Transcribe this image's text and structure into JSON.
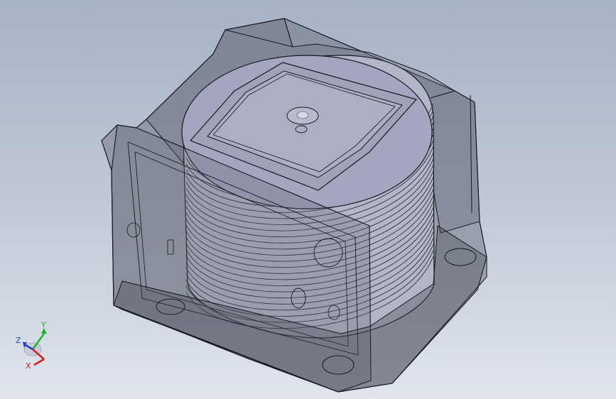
{
  "viewport": {
    "background_top": "#a6b2c6",
    "background_bottom": "#e0e5ee"
  },
  "model": {
    "shell_color": "#5d6270",
    "edge_color": "#16181d",
    "cylinder_color": "#b3b6c7",
    "top_face_color": "#a3a6be"
  },
  "triad": {
    "y_label": "Y",
    "z_label": "Z",
    "x_label": "X",
    "y_color": "#21b521",
    "z_color": "#1f3fd2",
    "x_color": "#d21f1f"
  }
}
